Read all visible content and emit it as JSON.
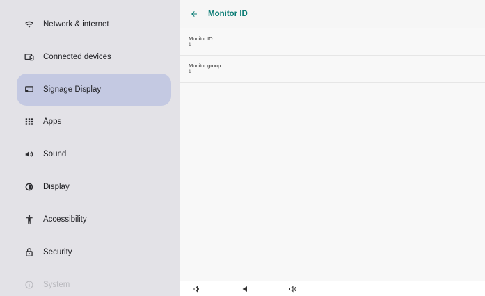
{
  "sidebar": {
    "items": [
      {
        "label": "Network & internet",
        "icon": "wifi-icon"
      },
      {
        "label": "Connected devices",
        "icon": "connected-devices-icon"
      },
      {
        "label": "Signage Display",
        "icon": "signage-display-icon",
        "active": true
      },
      {
        "label": "Apps",
        "icon": "apps-grid-icon"
      },
      {
        "label": "Sound",
        "icon": "volume-icon"
      },
      {
        "label": "Display",
        "icon": "brightness-icon"
      },
      {
        "label": "Accessibility",
        "icon": "accessibility-icon"
      },
      {
        "label": "Security",
        "icon": "lock-icon"
      },
      {
        "label": "System",
        "icon": "info-icon"
      }
    ],
    "active_color": "#c4c9e2",
    "background": "#e3e2e7"
  },
  "header": {
    "title": "Monitor ID",
    "accent_color": "#0b7c75"
  },
  "preferences": [
    {
      "title": "Monitor ID",
      "value": "1"
    },
    {
      "title": "Monitor group",
      "value": "1"
    }
  ],
  "navbar": {
    "buttons": [
      "volume-down-icon",
      "back-triangle-icon",
      "volume-up-icon"
    ]
  }
}
